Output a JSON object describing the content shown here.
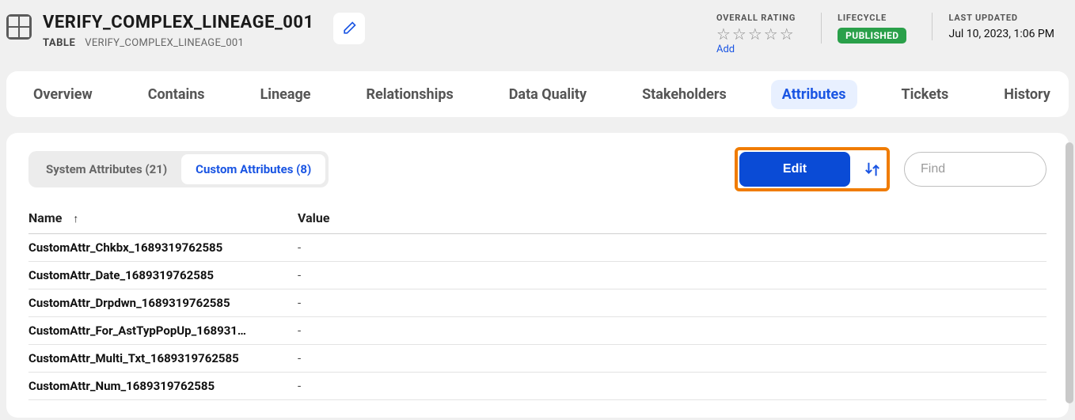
{
  "header": {
    "title": "VERIFY_COMPLEX_LINEAGE_001",
    "asset_type": "TABLE",
    "asset_path": "VERIFY_COMPLEX_LINEAGE_001",
    "rating_label": "OVERALL RATING",
    "rating_add": "Add",
    "lifecycle_label": "LIFECYCLE",
    "lifecycle_value": "PUBLISHED",
    "updated_label": "LAST UPDATED",
    "updated_value": "Jul 10, 2023, 1:06 PM"
  },
  "tabs": [
    "Overview",
    "Contains",
    "Lineage",
    "Relationships",
    "Data Quality",
    "Stakeholders",
    "Attributes",
    "Tickets",
    "History"
  ],
  "active_tab": "Attributes",
  "toolbar": {
    "system_label": "System Attributes (21)",
    "custom_label": "Custom Attributes (8)",
    "edit_label": "Edit",
    "find_placeholder": "Find"
  },
  "table": {
    "col_name": "Name",
    "col_value": "Value",
    "rows": [
      {
        "name": "CustomAttr_Chkbx_1689319762585",
        "value": "-"
      },
      {
        "name": "CustomAttr_Date_1689319762585",
        "value": "-"
      },
      {
        "name": "CustomAttr_Drpdwn_1689319762585",
        "value": "-"
      },
      {
        "name": "CustomAttr_For_AstTypPopUp_168931…",
        "value": "-"
      },
      {
        "name": "CustomAttr_Multi_Txt_1689319762585",
        "value": "-"
      },
      {
        "name": "CustomAttr_Num_1689319762585",
        "value": "-"
      }
    ]
  }
}
